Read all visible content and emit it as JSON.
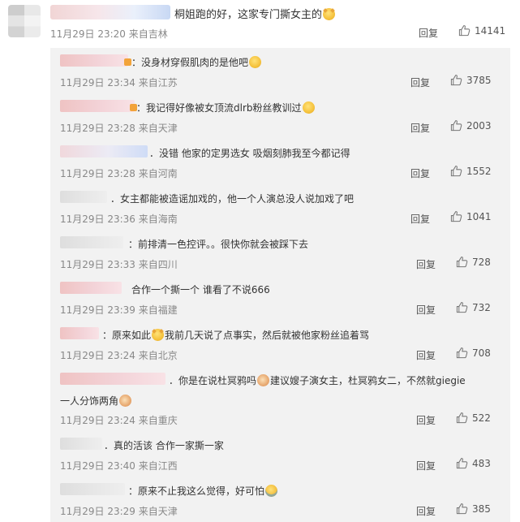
{
  "main_comment": {
    "text": "桐姐跑的好，这家专门撕女主的",
    "time": "11月29日 23:20",
    "location": "来自吉林",
    "reply_label": "回复",
    "likes": "14141",
    "emoji": "doge-emoji"
  },
  "replies": [
    {
      "text": "：没身材穿假肌肉的是他吧",
      "time": "11月29日 23:34",
      "location": "来自江苏",
      "reply_label": "回复",
      "likes": "3785"
    },
    {
      "text": "：我记得好像被女顶流dlrb粉丝教训过",
      "time": "11月29日 23:28",
      "location": "来自天津",
      "reply_label": "回复",
      "likes": "2003"
    },
    {
      "text": "．没错 他家的定男选女 吸烟刻肺我至今都记得",
      "time": "11月29日 23:28",
      "location": "来自河南",
      "reply_label": "回复",
      "likes": "1552"
    },
    {
      "text": "．女主都能被造谣加戏的，他一个人演总没人说加戏了吧",
      "time": "11月29日 23:36",
      "location": "来自海南",
      "reply_label": "回复",
      "likes": "1041"
    },
    {
      "text": "：前排清一色控评。。很快你就会被踩下去",
      "time": "11月29日 23:33",
      "location": "来自四川",
      "reply_label": "回复",
      "likes": "728"
    },
    {
      "text": "合作一个撕一个 谁看了不说666",
      "time": "11月29日 23:39",
      "location": "来自福建",
      "reply_label": "回复",
      "likes": "732"
    },
    {
      "text_a": "：原来如此",
      "text_b": "我前几天说了点事实，然后就被他家粉丝追着骂",
      "time": "11月29日 23:24",
      "location": "来自北京",
      "reply_label": "回复",
      "likes": "708"
    },
    {
      "text_a": "．你是在说杜冥鸦吗",
      "text_b": "建议嫂子演女主，杜冥鸦女二，不然就giegie",
      "text_c": "一人分饰两角",
      "time": "11月29日 23:24",
      "location": "来自重庆",
      "reply_label": "回复",
      "likes": "522"
    },
    {
      "text": "．真的活该 合作一家撕一家",
      "time": "11月29日 23:40",
      "location": "来自江西",
      "reply_label": "回复",
      "likes": "483"
    },
    {
      "text": "：原来不止我这么觉得，好可怕",
      "time": "11月29日 23:29",
      "location": "来自天津",
      "reply_label": "回复",
      "likes": "385"
    }
  ]
}
